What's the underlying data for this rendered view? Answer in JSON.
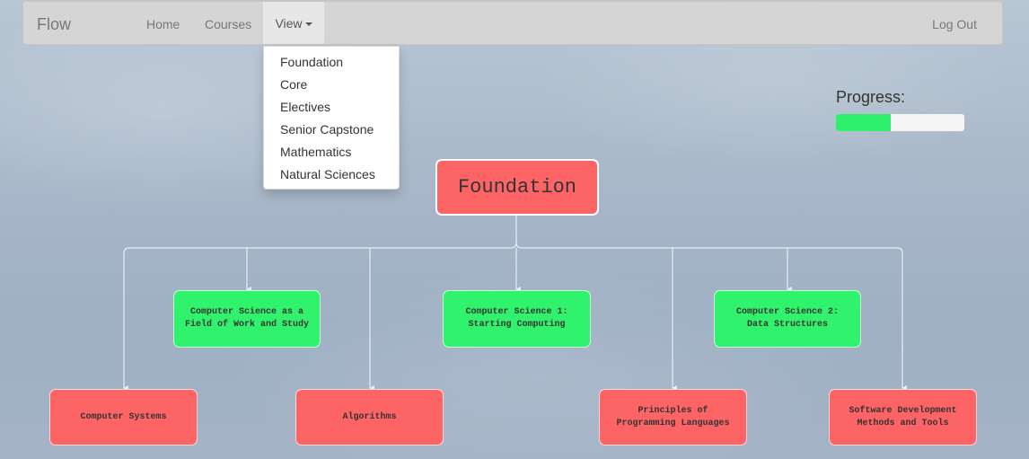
{
  "navbar": {
    "brand": "Flow",
    "links": [
      "Home",
      "Courses"
    ],
    "view_label": "View",
    "logout_label": "Log Out"
  },
  "view_menu": {
    "items": [
      "Foundation",
      "Core",
      "Electives",
      "Senior Capstone",
      "Mathematics",
      "Natural Sciences"
    ]
  },
  "progress": {
    "label": "Progress:",
    "fraction": 0.43,
    "fill_color": "#2ef06a"
  },
  "flowchart": {
    "root": "Foundation",
    "colors": {
      "incomplete": "#fd6466",
      "complete": "#30f26c"
    },
    "courses": [
      {
        "title": "Computer Science as a\nField of Work and Study",
        "status": "complete"
      },
      {
        "title": "Computer Science 1:\nStarting Computing",
        "status": "complete"
      },
      {
        "title": "Computer Science 2:\nData Structures",
        "status": "complete"
      },
      {
        "title": "Computer Systems",
        "status": "incomplete"
      },
      {
        "title": "Algorithms",
        "status": "incomplete"
      },
      {
        "title": "Principles of\nProgramming Languages",
        "status": "incomplete"
      },
      {
        "title": "Software Development\nMethods and Tools",
        "status": "incomplete"
      }
    ]
  }
}
